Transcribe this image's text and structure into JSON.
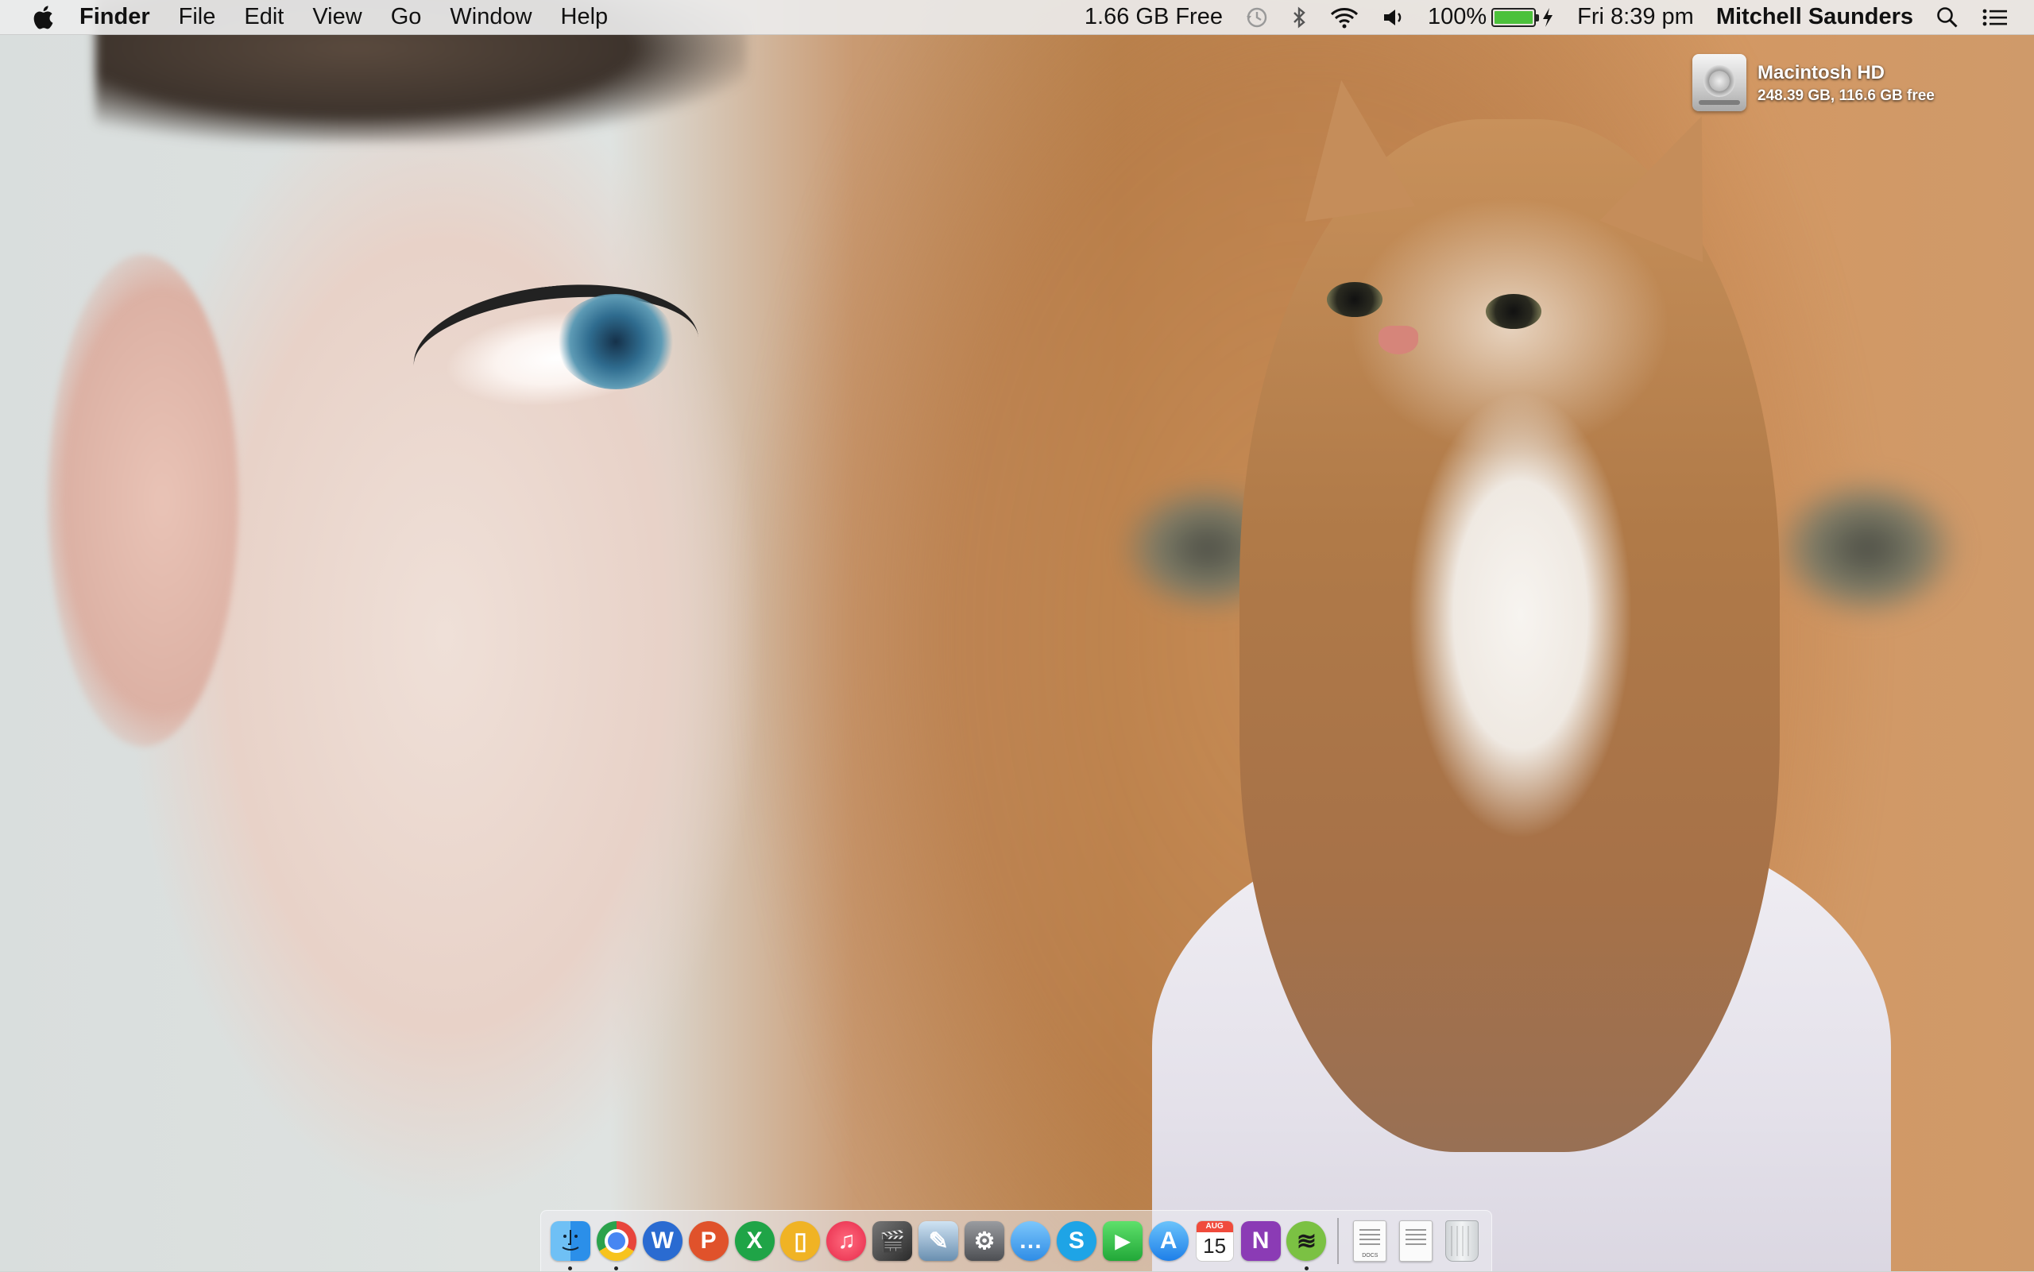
{
  "menubar": {
    "apple_icon": "apple-logo-icon",
    "app_name": "Finder",
    "menus": [
      "File",
      "Edit",
      "View",
      "Go",
      "Window",
      "Help"
    ],
    "memory_status": "1.66 GB Free",
    "battery_percent_label": "100%",
    "battery_level": 1.0,
    "datetime": "Fri 8:39 pm",
    "user_name": "Mitchell Saunders",
    "status_icons": [
      "time-machine-icon",
      "bluetooth-icon",
      "wifi-icon",
      "volume-icon",
      "battery-icon",
      "charging-icon",
      "spotlight-search-icon",
      "notification-center-icon"
    ]
  },
  "desktop": {
    "drive": {
      "name": "Macintosh HD",
      "info": "248.39 GB, 116.6 GB free",
      "icon": "hard-drive-icon"
    }
  },
  "dock": {
    "apps": [
      {
        "name": "Finder",
        "icon": "finder-icon",
        "running": true,
        "color": "#2b8fe9"
      },
      {
        "name": "Google Chrome",
        "icon": "chrome-icon",
        "running": true,
        "color": "#e8453c"
      },
      {
        "name": "Word",
        "icon": "word-icon",
        "glyph": "W",
        "running": false,
        "color": "#2a6bd1"
      },
      {
        "name": "PowerPoint",
        "icon": "powerpoint-icon",
        "glyph": "P",
        "running": false,
        "color": "#e0522b"
      },
      {
        "name": "Excel",
        "icon": "excel-icon",
        "glyph": "X",
        "running": false,
        "color": "#1fa447"
      },
      {
        "name": "Pages",
        "icon": "pages-icon",
        "glyph": "▯",
        "running": false,
        "color": "#f0b324"
      },
      {
        "name": "iTunes",
        "icon": "itunes-icon",
        "glyph": "♫",
        "running": false,
        "color": "#f2425a"
      },
      {
        "name": "Final Cut Pro",
        "icon": "final-cut-icon",
        "glyph": "🎬",
        "running": false,
        "color": "#3b3b3b"
      },
      {
        "name": "Preview",
        "icon": "preview-icon",
        "glyph": "✎",
        "running": false,
        "color": "#6a8fb0"
      },
      {
        "name": "System Preferences",
        "icon": "system-preferences-icon",
        "glyph": "⚙",
        "running": false,
        "color": "#6d6f73"
      },
      {
        "name": "Messages",
        "icon": "messages-icon",
        "glyph": "…",
        "running": false,
        "color": "#3ea4f0"
      },
      {
        "name": "Skype",
        "icon": "skype-icon",
        "glyph": "S",
        "running": false,
        "color": "#1ea4e6"
      },
      {
        "name": "FaceTime",
        "icon": "facetime-icon",
        "glyph": "▶",
        "running": false,
        "color": "#34c34b"
      },
      {
        "name": "App Store",
        "icon": "app-store-icon",
        "glyph": "A",
        "running": false,
        "color": "#2d8ef0"
      },
      {
        "name": "Calendar",
        "icon": "calendar-icon",
        "month": "AUG",
        "day": "15",
        "running": false,
        "color": "#f04b3c"
      },
      {
        "name": "OneNote",
        "icon": "onenote-icon",
        "glyph": "N",
        "running": false,
        "color": "#8b3bb5"
      },
      {
        "name": "Spotify",
        "icon": "spotify-icon",
        "glyph": "≋",
        "running": true,
        "color": "#7bc143"
      }
    ],
    "stack_items": [
      {
        "name": "Documents",
        "icon": "docs-stack-icon",
        "caption": "DOCS"
      },
      {
        "name": "Downloads",
        "icon": "downloads-stack-icon",
        "caption": ""
      },
      {
        "name": "Trash",
        "icon": "trash-icon"
      }
    ]
  }
}
